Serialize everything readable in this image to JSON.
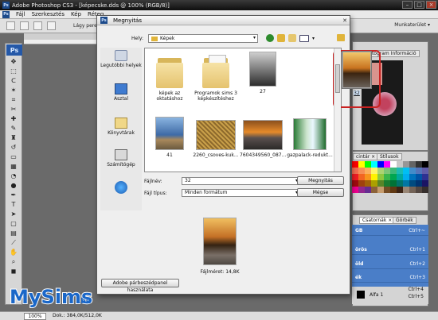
{
  "window": {
    "app_title": "Adobe Photoshop CS3 - [képecske.dds @ 100% (RGB/8)]",
    "ps": "Ps"
  },
  "menu": {
    "items": [
      "Fájl",
      "Szerkesztés",
      "Kép",
      "Réteg"
    ]
  },
  "options": {
    "label": "Lágy peremü",
    "workspace": "Munkaterület ▾"
  },
  "panels": {
    "histogram_tab": "isztogram  Információ",
    "swatch_tabs": [
      "cintár ×",
      "Stílusok"
    ],
    "layers_tabs": [
      "Csatornák ×",
      "Görbék"
    ],
    "layers_rows": [
      {
        "k": "GB",
        "s": "Ctrl+~"
      },
      {
        "k": "örös",
        "s": "Ctrl+1"
      },
      {
        "k": "öld",
        "s": "Ctrl+2"
      },
      {
        "k": "ék",
        "s": "Ctrl+3"
      },
      {
        "k": "",
        "s": "Ctrl+4"
      }
    ],
    "layer_name": "Alfa 1",
    "ctrl5": "Ctrl+5"
  },
  "dialog": {
    "title": "Megnyitás",
    "look_in_label": "Hely:",
    "look_in_value": "Képek",
    "places": [
      "Legutóbbi helyek",
      "Asztal",
      "Könyvtárak",
      "Számítógép"
    ],
    "files": [
      {
        "name": "képek az oktatáshoz",
        "kind": "folder"
      },
      {
        "name": "Programok sims 3 képkészítéshez",
        "kind": "folder"
      },
      {
        "name": "27",
        "kind": "image"
      },
      {
        "name": "32",
        "kind": "image",
        "selected": true
      },
      {
        "name": "41",
        "kind": "image"
      },
      {
        "name": "2260_csoves-kuk...",
        "kind": "image"
      },
      {
        "name": "7604349560_087...",
        "kind": "image"
      },
      {
        "name": "gazpalack-redukt...",
        "kind": "image"
      }
    ],
    "filename_label": "Fájlnév:",
    "filename_value": "32",
    "filetype_label": "Fájl típus:",
    "filetype_value": "Minden formátum",
    "open_button": "Megnyitás",
    "cancel_button": "Mégse",
    "filesize": "Fájlméret: 14,8K",
    "adobe_dialog_button": "Adobe párbeszédpanel használata"
  },
  "status": {
    "zoom": "100%",
    "doc": "Dok.: 384,0K/512,0K"
  },
  "watermark": {
    "text": "MySims",
    "suffix": ".hu"
  },
  "colors": {
    "selection": "#c92222",
    "layers_bg": "#4a7ec8",
    "ps_blue": "#2458a8"
  }
}
